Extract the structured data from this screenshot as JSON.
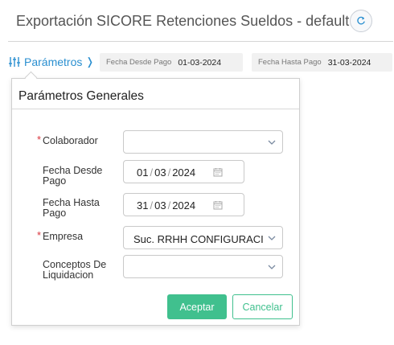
{
  "header": {
    "title": "Exportación SICORE Retenciones Sueldos - default",
    "refresh_icon": "refresh-icon"
  },
  "filter_bar": {
    "params_link": "Parámetros",
    "chips": [
      {
        "label": "Fecha Desde Pago",
        "value": "01-03-2024"
      },
      {
        "label": "Fecha Hasta Pago",
        "value": "31-03-2024"
      }
    ]
  },
  "popover": {
    "title": "Parámetros Generales",
    "fields": {
      "colaborador": {
        "label": "Colaborador",
        "required": "*",
        "value": ""
      },
      "fecha_desde": {
        "label_line1": "Fecha Desde",
        "label_line2": "Pago",
        "day": "01",
        "month": "03",
        "year": "2024",
        "sep": "/"
      },
      "fecha_hasta": {
        "label_line1": "Fecha Hasta",
        "label_line2": "Pago",
        "day": "31",
        "month": "03",
        "year": "2024",
        "sep": "/"
      },
      "empresa": {
        "label": "Empresa",
        "required": "*",
        "value": "Suc. RRHH CONFIGURACION"
      },
      "conceptos": {
        "label_line1": "Conceptos De",
        "label_line2": "Liquidacion",
        "value": ""
      }
    },
    "buttons": {
      "accept": "Aceptar",
      "cancel": "Cancelar"
    }
  },
  "colors": {
    "accent": "#40c08e",
    "link": "#2a8fd0",
    "required": "#d9363e"
  }
}
